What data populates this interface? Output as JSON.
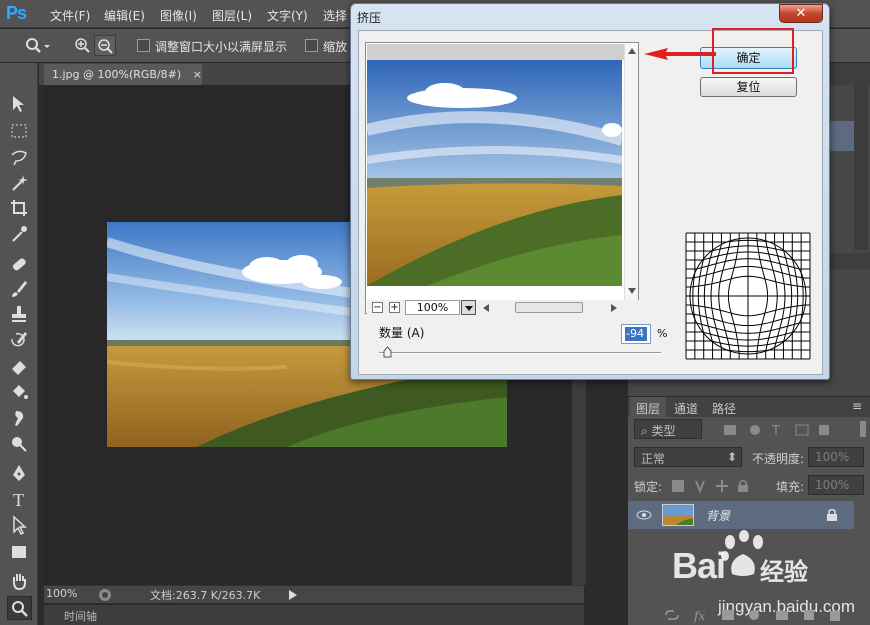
{
  "app": {
    "logo": "Ps",
    "menus": [
      "文件(F)",
      "编辑(E)",
      "图像(I)",
      "图层(L)",
      "文字(Y)",
      "选择"
    ]
  },
  "options_bar": {
    "fit_window_label": "调整窗口大小以满屏显示",
    "zoom_all_label": "缩放"
  },
  "document": {
    "tab_title": "1.jpg @ 100%(RGB/8#)",
    "tab_close": "×",
    "zoom": "100%",
    "doc_size": "文档:263.7 K/263.7K",
    "timeline_label": "时间轴"
  },
  "dialog": {
    "title": "挤压",
    "close": "✕",
    "ok_label": "确定",
    "reset_label": "复位",
    "preview_zoom": "100%",
    "zoom_out": "−",
    "zoom_in": "+",
    "amount_label": "数量 (A)",
    "amount_value": "-94",
    "amount_unit": "%",
    "amount_min": -100,
    "amount_max": 100,
    "amount_current": -94
  },
  "layers_panel": {
    "tabs": [
      "图层",
      "通道",
      "路径"
    ],
    "filter_label": "类型",
    "blend_mode": "正常",
    "opacity_label": "不透明度:",
    "opacity_value": "100%",
    "lock_label": "锁定:",
    "fill_label": "填充:",
    "fill_value": "100%",
    "layer_name": "背景"
  },
  "watermark": {
    "brand_latin": "Bai",
    "brand_cn": "经验",
    "url": "jingyan.baidu.com"
  },
  "colors": {
    "accent_red": "#e02020",
    "ps_blue": "#31a8ff",
    "amount_highlight": "#3a75c4"
  }
}
